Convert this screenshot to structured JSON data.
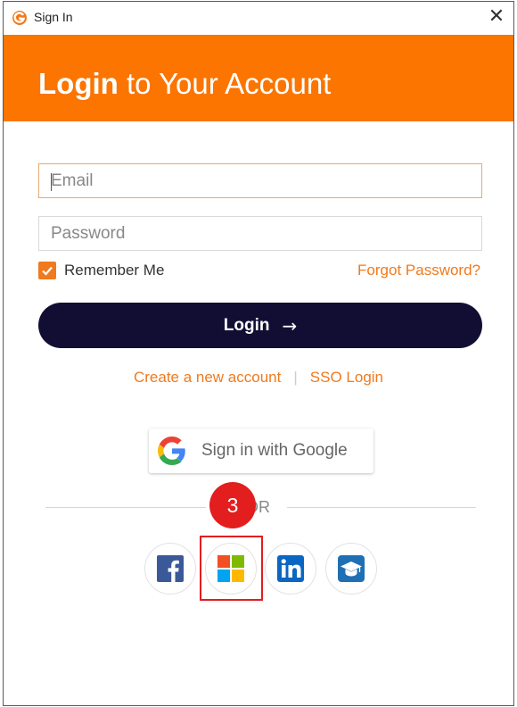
{
  "window": {
    "title": "Sign In"
  },
  "header": {
    "title_bold": "Login",
    "title_rest": " to Your Account",
    "background": "#fb7500"
  },
  "form": {
    "email_placeholder": "Email",
    "password_placeholder": "Password",
    "remember_label": "Remember Me",
    "remember_checked": true,
    "forgot_label": "Forgot Password?",
    "login_label": "Login",
    "login_arrow": "→"
  },
  "links": {
    "create_account": "Create a new account",
    "separator": "|",
    "sso_login": "SSO Login"
  },
  "google": {
    "label": "Sign in with Google"
  },
  "divider": {
    "label": "OR"
  },
  "annotation": {
    "step_number": "3",
    "highlight_color": "#e31e1e"
  },
  "social_buttons": [
    {
      "name": "facebook",
      "icon": "facebook-icon"
    },
    {
      "name": "microsoft",
      "icon": "microsoft-icon"
    },
    {
      "name": "linkedin",
      "icon": "linkedin-icon"
    },
    {
      "name": "education",
      "icon": "graduation-cap-icon"
    }
  ],
  "colors": {
    "accent": "#f07a1e",
    "login_button": "#120e33"
  }
}
